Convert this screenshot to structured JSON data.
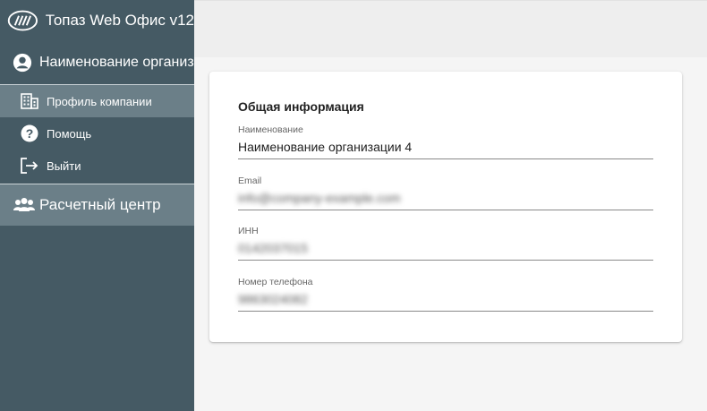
{
  "app": {
    "title": "Топаз Web Офис v12"
  },
  "sidebar": {
    "org_name": "Наименование организации",
    "items": [
      {
        "label": "Профиль компании",
        "icon": "building-icon",
        "active": true
      },
      {
        "label": "Помощь",
        "icon": "help-circle-icon",
        "active": false
      },
      {
        "label": "Выйти",
        "icon": "logout-icon",
        "active": false
      }
    ],
    "section": {
      "label": "Расчетный центр",
      "icon": "users-group-icon"
    }
  },
  "card": {
    "title": "Общая информация",
    "fields": [
      {
        "label": "Наименование",
        "value": "Наименование организации 4"
      },
      {
        "label": "Email",
        "value": "info@company-example.com",
        "blurred": true
      },
      {
        "label": "ИНН",
        "value": "0142037015",
        "blurred": true
      },
      {
        "label": "Номер телефона",
        "value": "9863024082",
        "blurred": true
      }
    ]
  },
  "colors": {
    "sidebar_bg": "#455a64",
    "sidebar_active": "#6b7f88",
    "page_bg": "#f5f5f5",
    "card_bg": "#ffffff"
  }
}
